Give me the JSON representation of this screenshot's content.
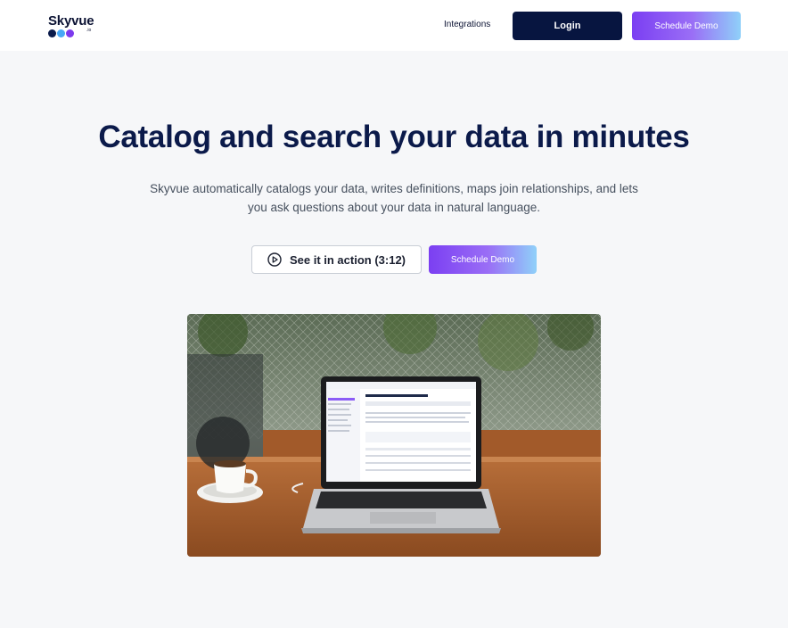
{
  "brand": {
    "name": "Skyvue",
    "suffix": ".io",
    "dot_colors": [
      "#0a1a4a",
      "#48a8f5",
      "#7c3aed"
    ]
  },
  "nav": {
    "integrations_label": "Integrations",
    "login_label": "Login",
    "schedule_demo_label": "Schedule Demo"
  },
  "hero": {
    "title": "Catalog and search your data in minutes",
    "subtitle": "Skyvue automatically catalogs your data, writes definitions, maps join relationships, and lets you ask questions about your data in natural language.",
    "watch_button_label": "See it in action (3:12)",
    "schedule_demo_label": "Schedule Demo",
    "image_icon": "laptop-on-cafe-table-photo"
  },
  "colors": {
    "navy": "#071540",
    "gradient_start": "#7b3ff2",
    "gradient_end": "#8fd0f9",
    "page_background": "#f6f7f9"
  }
}
